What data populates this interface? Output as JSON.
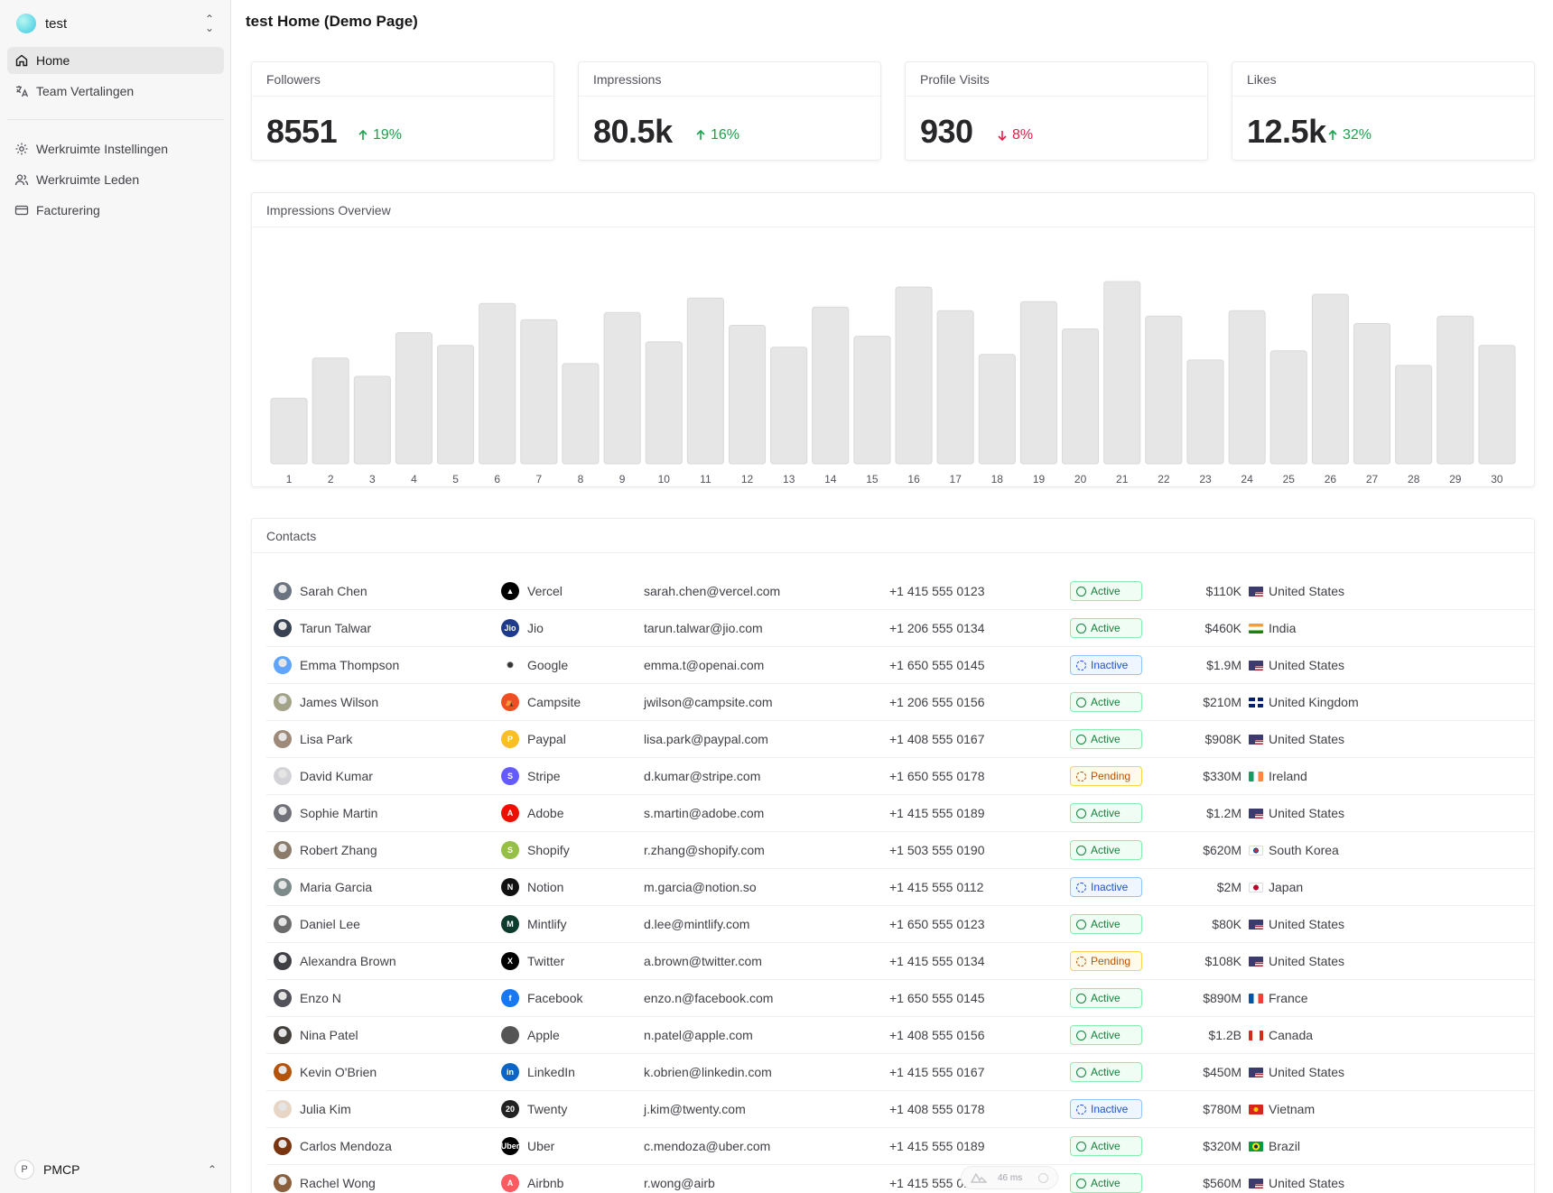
{
  "workspace": {
    "name": "test"
  },
  "sidebar": {
    "primary": [
      {
        "label": "Home",
        "icon": "home-icon",
        "active": true
      },
      {
        "label": "Team Vertalingen",
        "icon": "translate-icon",
        "active": false
      }
    ],
    "secondary": [
      {
        "label": "Werkruimte Instellingen",
        "icon": "settings-icon"
      },
      {
        "label": "Werkruimte Leden",
        "icon": "users-icon"
      },
      {
        "label": "Facturering",
        "icon": "credit-card-icon"
      }
    ],
    "user": {
      "initial": "P",
      "name": "PMCP"
    }
  },
  "page": {
    "title": "test Home (Demo Page)"
  },
  "stats": [
    {
      "label": "Followers",
      "value": "8551",
      "delta": "19%",
      "direction": "up"
    },
    {
      "label": "Impressions",
      "value": "80.5k",
      "delta": "16%",
      "direction": "up"
    },
    {
      "label": "Profile Visits",
      "value": "930",
      "delta": "8%",
      "direction": "down"
    },
    {
      "label": "Likes",
      "value": "12.5k",
      "delta": "32%",
      "direction": "up"
    }
  ],
  "chart_title": "Impressions Overview",
  "chart_data": {
    "type": "bar",
    "categories": [
      "1",
      "2",
      "3",
      "4",
      "5",
      "6",
      "7",
      "8",
      "9",
      "10",
      "11",
      "12",
      "13",
      "14",
      "15",
      "16",
      "17",
      "18",
      "19",
      "20",
      "21",
      "22",
      "23",
      "24",
      "25",
      "26",
      "27",
      "28",
      "29",
      "30"
    ],
    "values": [
      36,
      58,
      48,
      72,
      65,
      88,
      79,
      55,
      83,
      67,
      91,
      76,
      64,
      86,
      70,
      97,
      84,
      60,
      89,
      74,
      100,
      81,
      57,
      84,
      62,
      93,
      77,
      54,
      81,
      65
    ],
    "bar_color": "#e6e6e6",
    "grid": false
  },
  "contacts": {
    "title": "Contacts",
    "rows": [
      {
        "name": "Sarah Chen",
        "company": "Vercel",
        "email": "sarah.chen@vercel.com",
        "phone": "+1 415 555 0123",
        "status": "Active",
        "value": "$110K",
        "country": "United States",
        "flag": "us",
        "logo_color": "#000000",
        "logo_text": "▲",
        "avatar_color": "#6b7280"
      },
      {
        "name": "Tarun Talwar",
        "company": "Jio",
        "email": "tarun.talwar@jio.com",
        "phone": "+1 206 555 0134",
        "status": "Active",
        "value": "$460K",
        "country": "India",
        "flag": "in",
        "logo_color": "#1e3a8a",
        "logo_text": "Jio",
        "avatar_color": "#374151"
      },
      {
        "name": "Emma Thompson",
        "company": "Google",
        "email": "emma.t@openai.com",
        "phone": "+1 650 555 0145",
        "status": "Inactive",
        "value": "$1.9M",
        "country": "United States",
        "flag": "us",
        "logo_color": "#ffffff",
        "logo_text": "✺",
        "avatar_color": "#60a5fa"
      },
      {
        "name": "James Wilson",
        "company": "Campsite",
        "email": "jwilson@campsite.com",
        "phone": "+1 206 555 0156",
        "status": "Active",
        "value": "$210M",
        "country": "United Kingdom",
        "flag": "gb",
        "logo_color": "#f04e23",
        "logo_text": "⛺",
        "avatar_color": "#a3a38a"
      },
      {
        "name": "Lisa Park",
        "company": "Paypal",
        "email": "lisa.park@paypal.com",
        "phone": "+1 408 555 0167",
        "status": "Active",
        "value": "$908K",
        "country": "United States",
        "flag": "us",
        "logo_color": "#fbbf24",
        "logo_text": "P",
        "avatar_color": "#9f8a7a"
      },
      {
        "name": "David Kumar",
        "company": "Stripe",
        "email": "d.kumar@stripe.com",
        "phone": "+1 650 555 0178",
        "status": "Pending",
        "value": "$330M",
        "country": "Ireland",
        "flag": "ie",
        "logo_color": "#635bff",
        "logo_text": "S",
        "avatar_color": "#d4d4d8"
      },
      {
        "name": "Sophie Martin",
        "company": "Adobe",
        "email": "s.martin@adobe.com",
        "phone": "+1 415 555 0189",
        "status": "Active",
        "value": "$1.2M",
        "country": "United States",
        "flag": "us",
        "logo_color": "#eb1000",
        "logo_text": "A",
        "avatar_color": "#71717a"
      },
      {
        "name": "Robert Zhang",
        "company": "Shopify",
        "email": "r.zhang@shopify.com",
        "phone": "+1 503 555 0190",
        "status": "Active",
        "value": "$620M",
        "country": "South Korea",
        "flag": "kr",
        "logo_color": "#95bf47",
        "logo_text": "S",
        "avatar_color": "#8b7b6b"
      },
      {
        "name": "Maria Garcia",
        "company": "Notion",
        "email": "m.garcia@notion.so",
        "phone": "+1 415 555 0112",
        "status": "Inactive",
        "value": "$2M",
        "country": "Japan",
        "flag": "jp",
        "logo_color": "#111111",
        "logo_text": "N",
        "avatar_color": "#7c8b8a"
      },
      {
        "name": "Daniel Lee",
        "company": "Mintlify",
        "email": "d.lee@mintlify.com",
        "phone": "+1 650 555 0123",
        "status": "Active",
        "value": "$80K",
        "country": "United States",
        "flag": "us",
        "logo_color": "#0d3b2e",
        "logo_text": "M",
        "avatar_color": "#6b6b6b"
      },
      {
        "name": "Alexandra Brown",
        "company": "Twitter",
        "email": "a.brown@twitter.com",
        "phone": "+1 415 555 0134",
        "status": "Pending",
        "value": "$108K",
        "country": "United States",
        "flag": "us",
        "logo_color": "#000000",
        "logo_text": "X",
        "avatar_color": "#3f3f46"
      },
      {
        "name": "Enzo N",
        "company": "Facebook",
        "email": "enzo.n@facebook.com",
        "phone": "+1 650 555 0145",
        "status": "Active",
        "value": "$890M",
        "country": "France",
        "flag": "fr",
        "logo_color": "#1877f2",
        "logo_text": "f",
        "avatar_color": "#52525b"
      },
      {
        "name": "Nina Patel",
        "company": "Apple",
        "email": "n.patel@apple.com",
        "phone": "+1 408 555 0156",
        "status": "Active",
        "value": "$1.2B",
        "country": "Canada",
        "flag": "ca",
        "logo_color": "#555555",
        "logo_text": "",
        "avatar_color": "#44403c"
      },
      {
        "name": "Kevin O'Brien",
        "company": "LinkedIn",
        "email": "k.obrien@linkedin.com",
        "phone": "+1 415 555 0167",
        "status": "Active",
        "value": "$450M",
        "country": "United States",
        "flag": "us",
        "logo_color": "#0a66c2",
        "logo_text": "in",
        "avatar_color": "#b45309"
      },
      {
        "name": "Julia Kim",
        "company": "Twenty",
        "email": "j.kim@twenty.com",
        "phone": "+1 408 555 0178",
        "status": "Inactive",
        "value": "$780M",
        "country": "Vietnam",
        "flag": "vn",
        "logo_color": "#222222",
        "logo_text": "20",
        "avatar_color": "#e7d5c5"
      },
      {
        "name": "Carlos Mendoza",
        "company": "Uber",
        "email": "c.mendoza@uber.com",
        "phone": "+1 415 555 0189",
        "status": "Active",
        "value": "$320M",
        "country": "Brazil",
        "flag": "br",
        "logo_color": "#000000",
        "logo_text": "Uber",
        "avatar_color": "#78350f"
      },
      {
        "name": "Rachel Wong",
        "company": "Airbnb",
        "email": "r.wong@airb",
        "phone": "+1 415 555 0190",
        "status": "Active",
        "value": "$560M",
        "country": "United States",
        "flag": "us",
        "logo_color": "#ff5a5f",
        "logo_text": "A",
        "avatar_color": "#8b5e3c"
      }
    ]
  },
  "dev_tool": {
    "timing": "46 ms"
  }
}
